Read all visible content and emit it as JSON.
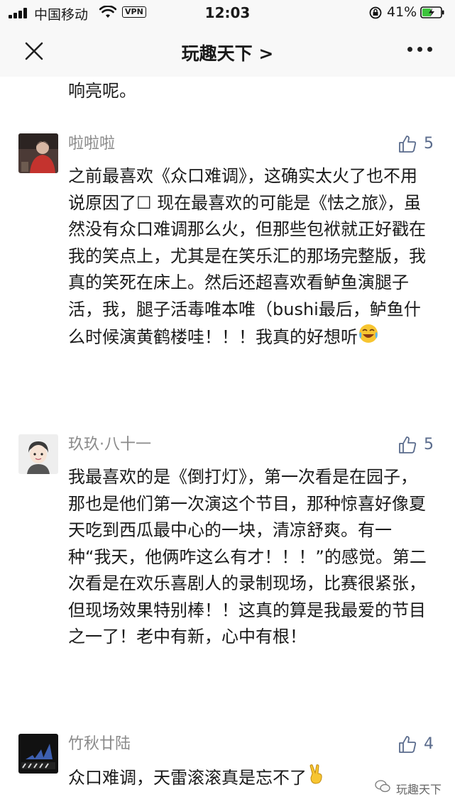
{
  "status_bar": {
    "carrier": "中国移动",
    "vpn": "VPN",
    "time": "12:03",
    "battery": "41%"
  },
  "nav": {
    "title": "玩趣天下 >"
  },
  "previous_comment_tail": "响亮呢。",
  "comments": [
    {
      "author": "啦啦啦",
      "likes": "5",
      "text": "之前最喜欢《众口难调》，这确实太火了也不用说原因了☐ 现在最喜欢的可能是《怯之旅》，虽然没有众口难调那么火，但那些包袱就正好戳在我的笑点上，尤其是在笑乐汇的那场完整版，我真的笑死在床上。然后还超喜欢看鲈鱼演腿子活，我，腿子活毒唯本唯（bushi最后，鲈鱼什么时候演黄鹤楼哇！！！我真的好想听",
      "emoji": "laughing-crying-emoji"
    },
    {
      "author": "玖玖·八十一",
      "likes": "5",
      "text": "我最喜欢的是《倒打灯》，第一次看是在园子，那也是他们第一次演这个节目，那种惊喜好像夏天吃到西瓜最中心的一块，清凉舒爽。有一种“我天，他俩咋这么有才！！！”的感觉。第二次看是在欢乐喜剧人的录制现场，比赛很紧张，但现场效果特别棒！！这真的算是我最爱的节目之一了！老中有新，心中有根！"
    },
    {
      "author": "竹秋廿陆",
      "likes": "4",
      "text": "众口难调，天雷滚滚真是忘不了",
      "emoji": "victory-hand-emoji"
    }
  ],
  "watermark": "玩趣天下",
  "colors": {
    "like_count": "#5a6b8c",
    "username": "#8a8a8a",
    "header_bg": "#f8f8f8"
  }
}
